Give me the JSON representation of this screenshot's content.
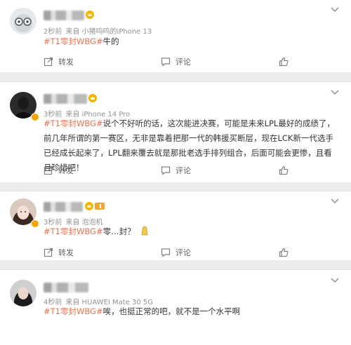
{
  "posts": [
    {
      "meta": {
        "time": "2秒前",
        "source": "来自 小猪呜呜的iPhone 13"
      },
      "tag": "#T1零封WBG#",
      "body": "牛的",
      "actions": {
        "repost": "转发",
        "comment": "评论"
      }
    },
    {
      "meta": {
        "time": "3秒前",
        "source": "来自 iPhone 14 Pro"
      },
      "tag": "#T1零封WBG#",
      "body": "说个不好听的话，这次能进决赛，可能是未来LPL最好的成绩了，前几年所谓的第一赛区，无非是靠着把那一代的韩援买断层，现在LCK新一代选手已经成长起来了，LPL翻来覆去就是那批老选手排列组合，后面可能会更惨，且看且珍惜吧！",
      "actions": {
        "repost": "转发",
        "comment": "评论"
      }
    },
    {
      "meta": {
        "time": "3秒前",
        "source": "来自 泡泡机"
      },
      "tag": "#T1零封WBG#",
      "body": "零…封？",
      "actions": {
        "repost": "转发",
        "comment": "评论"
      }
    },
    {
      "meta": {
        "time": "4秒前",
        "source": "来自 HUAWEI Mate 30 5G"
      },
      "tag": "#T1零封WBG#",
      "body": "唉，也挺正常的吧，就不是一个水平啊"
    }
  ],
  "icons": {
    "repost": "share-icon",
    "comment": "comment-icon",
    "like": "thumbs-up-icon",
    "more": "chevron-down-icon"
  },
  "colors": {
    "topic": "#eb7350",
    "meta": "#939393",
    "background": "#ececec"
  }
}
